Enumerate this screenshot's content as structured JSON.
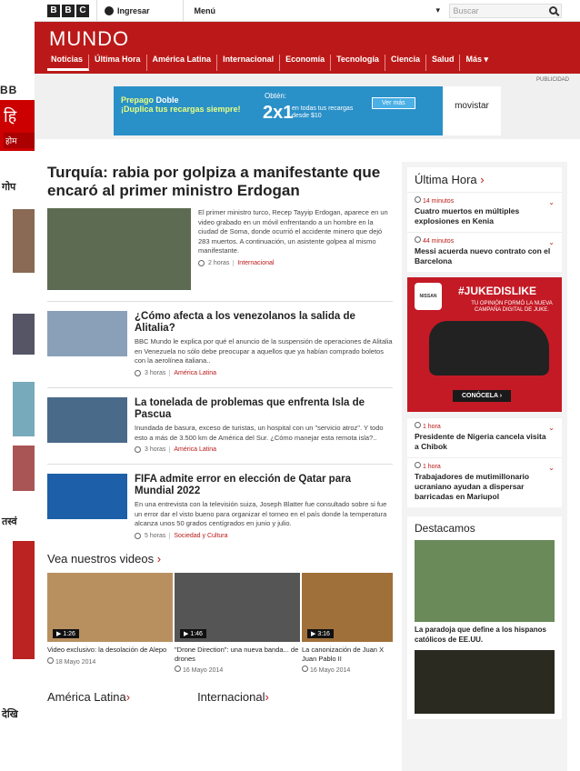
{
  "behind": {
    "hindi_title": "हि",
    "hindi_nav": "होम",
    "side_texts": [
      "गोप",
      "तस्वं",
      "देखि"
    ]
  },
  "topbar": {
    "bbc": [
      "B",
      "B",
      "C"
    ],
    "signin": "Ingresar",
    "menu": "Menú",
    "search_placeholder": "Buscar"
  },
  "header": {
    "title": "MUNDO",
    "nav": [
      "Noticias",
      "Última Hora",
      "América Latina",
      "Internacional",
      "Economía",
      "Tecnología",
      "Ciencia",
      "Salud",
      "Más ▾"
    ]
  },
  "ad": {
    "label": "PUBLICIDAD",
    "prepago": "Prepago",
    "doble": "Doble",
    "tagline": "¡Duplica tus recargas siempre!",
    "obten": "Obtén:",
    "big": "2x1",
    "small": "en todas tus recargas desde $10",
    "cta": "Ver más",
    "brand": "movistar"
  },
  "lead": {
    "title": "Turquía: rabia por golpiza a manifestante que encaró al primer ministro Erdogan",
    "desc": "El primer ministro turco, Recep Tayyip Erdogan, aparece en un video grabado en un móvil enfrentando a un hombre en la ciudad de Soma, donde ocurrió el accidente minero que dejó 283 muertos. A continuación, un asistente golpea al mismo manifestante.",
    "time": "2 horas",
    "cat": "Internacional"
  },
  "stories": [
    {
      "title": "¿Cómo afecta a los venezolanos la salida de Alitalia?",
      "desc": "BBC Mundo le explica por qué el anuncio de la suspensión de operaciones de Alitalia en Venezuela no sólo debe preocupar a aquellos que ya habían comprado boletos con la aerolínea italiana..",
      "time": "3 horas",
      "cat": "América Latina"
    },
    {
      "title": "La tonelada de problemas que enfrenta Isla de Pascua",
      "desc": "Inundada de basura, exceso de turistas, un hospital con un \"servicio atroz\". Y todo esto a más de 3.500 km de América del Sur. ¿Cómo manejar esta remota isla?..",
      "time": "3 horas",
      "cat": "América Latina"
    },
    {
      "title": "FIFA admite error en elección de Qatar para Mundial 2022",
      "desc": "En una entrevista con la televisión suiza, Joseph Blatter fue consultado sobre si fue un error dar el visto bueno para organizar el torneo en el país donde la temperatura alcanza unos 50 grados centígrados en junio y julio.",
      "time": "5 horas",
      "cat": "Sociedad y Cultura"
    }
  ],
  "videos": {
    "title": "Vea nuestros videos",
    "items": [
      {
        "dur": "1:26",
        "title": "Video exclusivo: la desolación de Alepo",
        "date": "18 Mayo 2014"
      },
      {
        "dur": "1:46",
        "title": "\"Drone Direction\": una nueva banda... de drones",
        "date": "16 Mayo 2014"
      },
      {
        "dur": "3:16",
        "title": "La canonización de Juan X Juan Pablo II",
        "date": "16 Mayo 2014"
      }
    ]
  },
  "bottom": {
    "left": "América Latina",
    "right": "Internacional"
  },
  "sidebar": {
    "title": "Última Hora",
    "items": [
      {
        "time": "14 minutos",
        "title": "Cuatro muertos en múltiples explosiones en Kenia"
      },
      {
        "time": "44 minutos",
        "title": "Messi acuerda nuevo contrato con el Barcelona"
      },
      {
        "time": "1 hora",
        "title": "Presidente de Nigeria cancela visita a Chibok"
      },
      {
        "time": "1 hora",
        "title": "Trabajadores de mutimillonario ucraniano ayudan a dispersar barricadas en Mariupol"
      }
    ]
  },
  "juke": {
    "brand": "NISSAN",
    "title": "#JUKEDISLIKE",
    "sub": "TU OPINIÓN FORMÓ LA NUEVA CAMPAÑA DIGITAL DE JUKE.",
    "cta": "CONÓCELA ›"
  },
  "destacamos": {
    "title": "Destacamos",
    "items": [
      {
        "title": "La paradoja que define a los hispanos católicos de EE.UU."
      }
    ]
  }
}
